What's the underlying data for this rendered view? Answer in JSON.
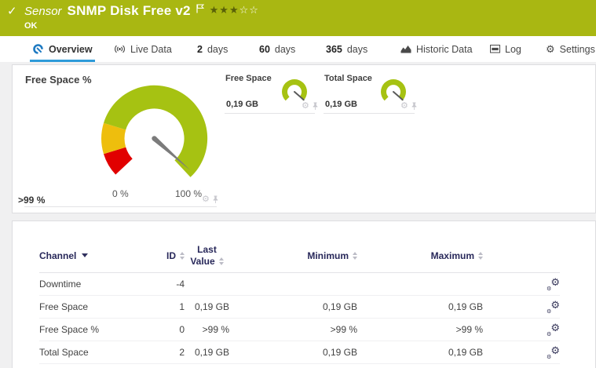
{
  "colors": {
    "header_bg": "#a9b712",
    "accent_blue": "#2e9bd9",
    "gauge_green": "#a6c212",
    "gauge_yellow": "#eebe0d",
    "gauge_red": "#e10000",
    "needle_gray": "#7b7b7b",
    "table_header_text": "#28285a"
  },
  "header": {
    "check": "✓",
    "kind": "Sensor",
    "title": "SNMP Disk Free v2",
    "status": "OK",
    "stars_filled": "★★★",
    "stars_empty": "☆☆"
  },
  "tabs": [
    {
      "label": "Overview"
    },
    {
      "label": "Live Data"
    },
    {
      "num": "2",
      "label": "days"
    },
    {
      "num": "60",
      "label": "days"
    },
    {
      "num": "365",
      "label": "days"
    },
    {
      "label": "Historic Data"
    },
    {
      "label": "Log"
    },
    {
      "label": "Settings"
    }
  ],
  "gauges": {
    "main": {
      "title": "Free Space %",
      "value": ">99 %",
      "scale_min": "0 %",
      "scale_max": "100 %"
    },
    "free_space": {
      "title": "Free Space",
      "value": "0,19 GB"
    },
    "total_space": {
      "title": "Total Space",
      "value": "0,19 GB"
    }
  },
  "table": {
    "headers": {
      "channel": "Channel",
      "id": "ID",
      "last_line1": "Last",
      "last_line2": "Value",
      "min": "Minimum",
      "max": "Maximum"
    },
    "rows": [
      {
        "channel": "Downtime",
        "id": "-4",
        "last": "",
        "min": "",
        "max": ""
      },
      {
        "channel": "Free Space",
        "id": "1",
        "last": "0,19 GB",
        "min": "0,19 GB",
        "max": "0,19 GB"
      },
      {
        "channel": "Free Space %",
        "id": "0",
        "last": ">99 %",
        "min": ">99 %",
        "max": ">99 %"
      },
      {
        "channel": "Total Space",
        "id": "2",
        "last": "0,19 GB",
        "min": "0,19 GB",
        "max": "0,19 GB"
      }
    ]
  }
}
